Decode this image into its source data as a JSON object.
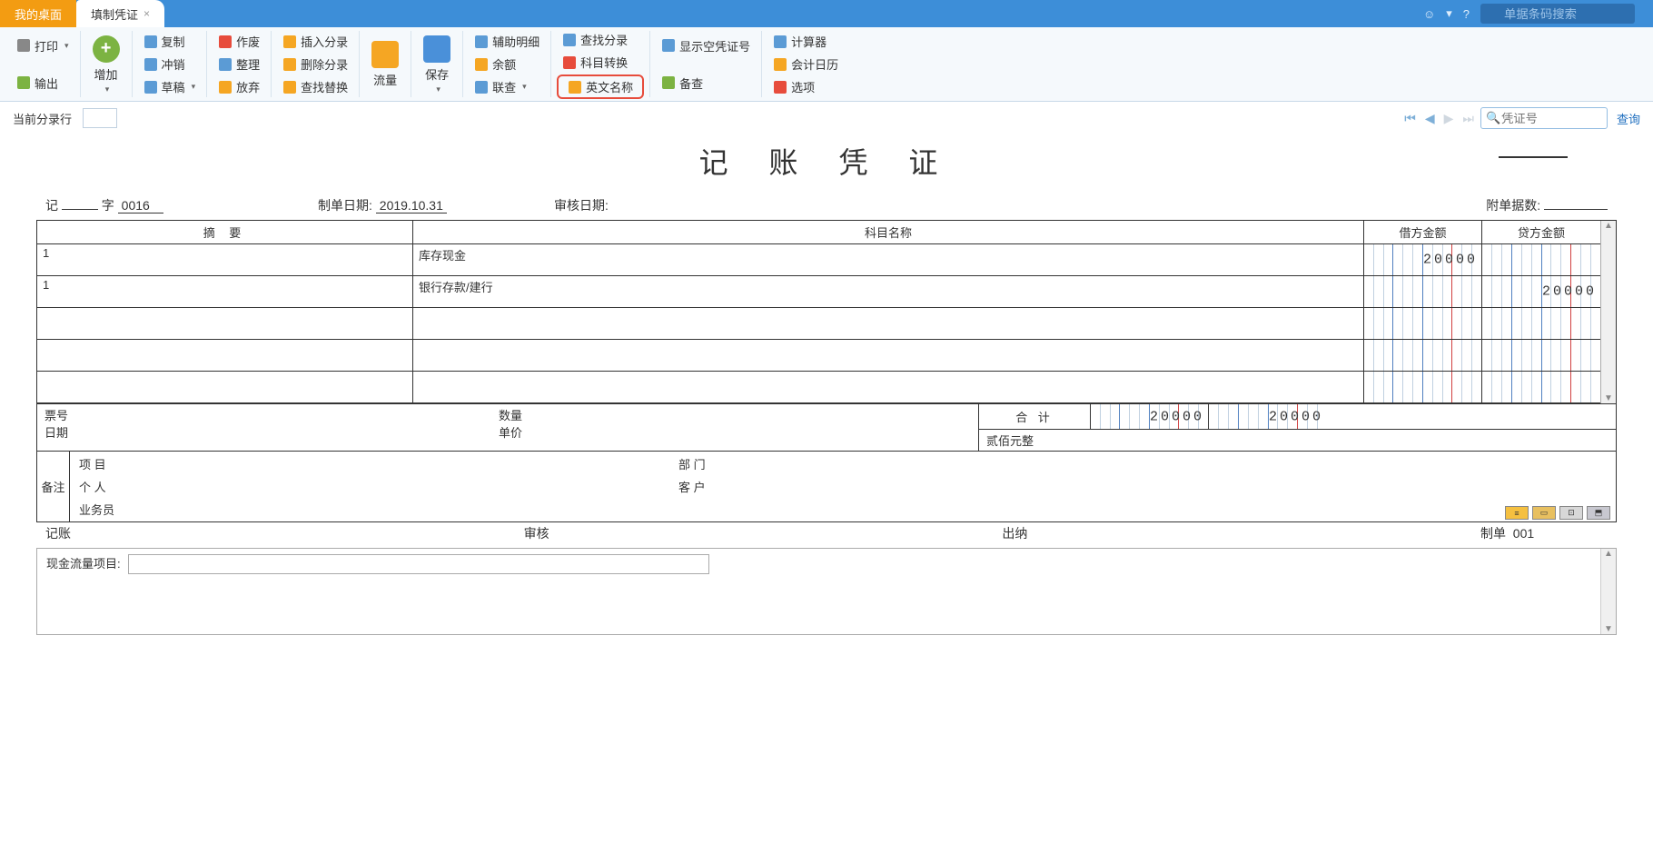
{
  "topbar": {
    "tab_desktop": "我的桌面",
    "tab_voucher": "填制凭证",
    "search_placeholder": "单据条码搜索"
  },
  "ribbon": {
    "print": "打印",
    "output": "输出",
    "add": "增加",
    "copy": "复制",
    "offset": "冲销",
    "draft": "草稿",
    "void": "作废",
    "tidy": "整理",
    "abandon": "放弃",
    "insert_entry": "插入分录",
    "delete_entry": "删除分录",
    "find_replace": "查找替换",
    "flow": "流量",
    "save": "保存",
    "aux_detail": "辅助明细",
    "balance": "余额",
    "linked": "联查",
    "find_entry": "查找分录",
    "acct_convert": "科目转换",
    "english_name": "英文名称",
    "show_empty": "显示空凭证号",
    "audit": "备查",
    "calculator": "计算器",
    "acct_calendar": "会计日历",
    "options": "选项"
  },
  "navrow": {
    "current_entry": "当前分录行",
    "voucher_no_ph": "凭证号",
    "query": "查询"
  },
  "voucher": {
    "title": "记 账 凭 证",
    "prefix": "记",
    "word": "字",
    "number": "0016",
    "make_date_label": "制单日期:",
    "make_date": "2019.10.31",
    "audit_date_label": "审核日期:",
    "attachments_label": "附单据数:",
    "header_summary": "摘 要",
    "header_account": "科目名称",
    "header_debit": "借方金额",
    "header_credit": "贷方金额",
    "rows": [
      {
        "summary": "1",
        "account": "库存现金",
        "debit": "20000",
        "credit": ""
      },
      {
        "summary": "1",
        "account": "银行存款/建行",
        "debit": "",
        "credit": "20000"
      },
      {
        "summary": "",
        "account": "",
        "debit": "",
        "credit": ""
      },
      {
        "summary": "",
        "account": "",
        "debit": "",
        "credit": ""
      },
      {
        "summary": "",
        "account": "",
        "debit": "",
        "credit": ""
      }
    ],
    "ticket_no": "票号",
    "date_lbl": "日期",
    "qty_lbl": "数量",
    "price_lbl": "单价",
    "total_lbl": "合 计",
    "total_debit": "20000",
    "total_credit": "20000",
    "amount_words": "贰佰元整",
    "remark_lbl": "备注",
    "project_lbl": "项  目",
    "dept_lbl": "部  门",
    "person_lbl": "个  人",
    "customer_lbl": "客  户",
    "salesman_lbl": "业务员",
    "sig_bookkeep": "记账",
    "sig_audit": "审核",
    "sig_cashier": "出纳",
    "sig_maker": "制单",
    "maker_val": "001"
  },
  "cashflow": {
    "label": "现金流量项目:"
  }
}
